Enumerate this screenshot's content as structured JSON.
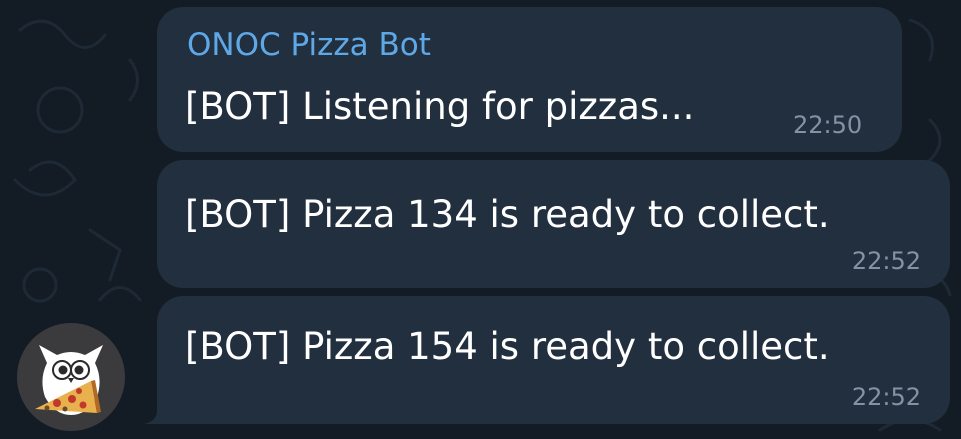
{
  "chat": {
    "messages": [
      {
        "sender": "ONOC Pizza Bot",
        "text": "[BOT] Listening for pizzas...",
        "time": "22:50"
      },
      {
        "text": "[BOT] Pizza 134 is ready to collect.",
        "time": "22:52"
      },
      {
        "text": "[BOT] Pizza 154 is ready to collect.",
        "time": "22:52"
      }
    ],
    "avatar_icon": "owl-pizza-icon"
  },
  "colors": {
    "background": "#131c25",
    "bubble": "#222f3e",
    "sender_name": "#5fa8e8",
    "message_text": "#ffffff",
    "timestamp": "#8493a4"
  }
}
